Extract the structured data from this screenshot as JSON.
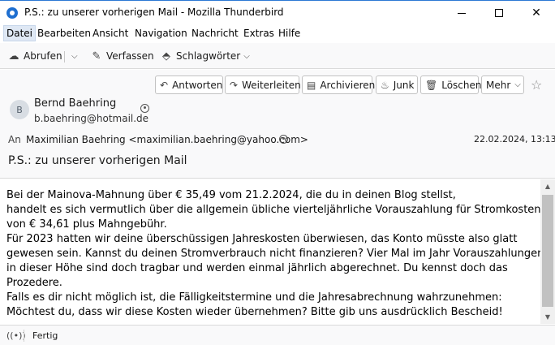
{
  "window": {
    "title": "P.S.: zu unserer vorherigen Mail - Mozilla Thunderbird",
    "minimize_glyph": "",
    "close_glyph": "✕"
  },
  "menu": [
    "Datei",
    "Bearbeiten",
    "Ansicht",
    "Navigation",
    "Nachricht",
    "Extras",
    "Hilfe"
  ],
  "toolbar": {
    "get_mail": "Abrufen",
    "write": "Verfassen",
    "tags": "Schlagwörter",
    "icons": {
      "get_mail": "cloud-download-icon",
      "write": "pencil-icon",
      "tags": "tag-icon"
    }
  },
  "message_actions": {
    "reply": "Antworten",
    "forward": "Weiterleiten",
    "archive": "Archivieren",
    "junk": "Junk",
    "delete": "Löschen",
    "more": "Mehr"
  },
  "message": {
    "avatar_initial": "B",
    "from_name": "Bernd Baehring",
    "from_email": "b.baehring@hotmail.de",
    "to_label": "An",
    "to_value": "Maximilian Baehring <maximilian.baehring@yahoo.com>",
    "date": "22.02.2024, 13:13",
    "subject": "P.S.: zu unserer vorherigen Mail",
    "body_lines": [
      "Bei der Mainova-Mahnung über € 35,49 vom 21.2.2024, die du in deinen Blog stellst,",
      "handelt es sich vermutlich über die allgemein übliche vierteljährliche Vorauszahlung für Stromkosten",
      "von € 34,61 plus Mahngebühr.",
      "Für 2023 hatten wir deine überschüssigen Jahreskosten überwiesen, das Konto müsste also glatt",
      "gewesen sein. Kannst du deinen Stromverbrauch nicht finanzieren? Vier Mal im Jahr Vorauszahlungen",
      "in dieser Höhe sind doch tragbar und werden einmal jährlich abgerechnet. Du kennst doch das",
      "Prozedere.",
      "Falls es dir nicht möglich ist, die Fälligkeitstermine und die Jahresabrechnung wahrzunehmen:",
      "Möchtest du, dass wir diese Kosten wieder übernehmen? Bitte gib uns ausdrücklich Bescheid!"
    ]
  },
  "status": {
    "text": "Fertig"
  },
  "colors": {
    "accent": "#2b78d4",
    "toolbar_bg": "#f9f9fa",
    "border": "#dadada"
  }
}
